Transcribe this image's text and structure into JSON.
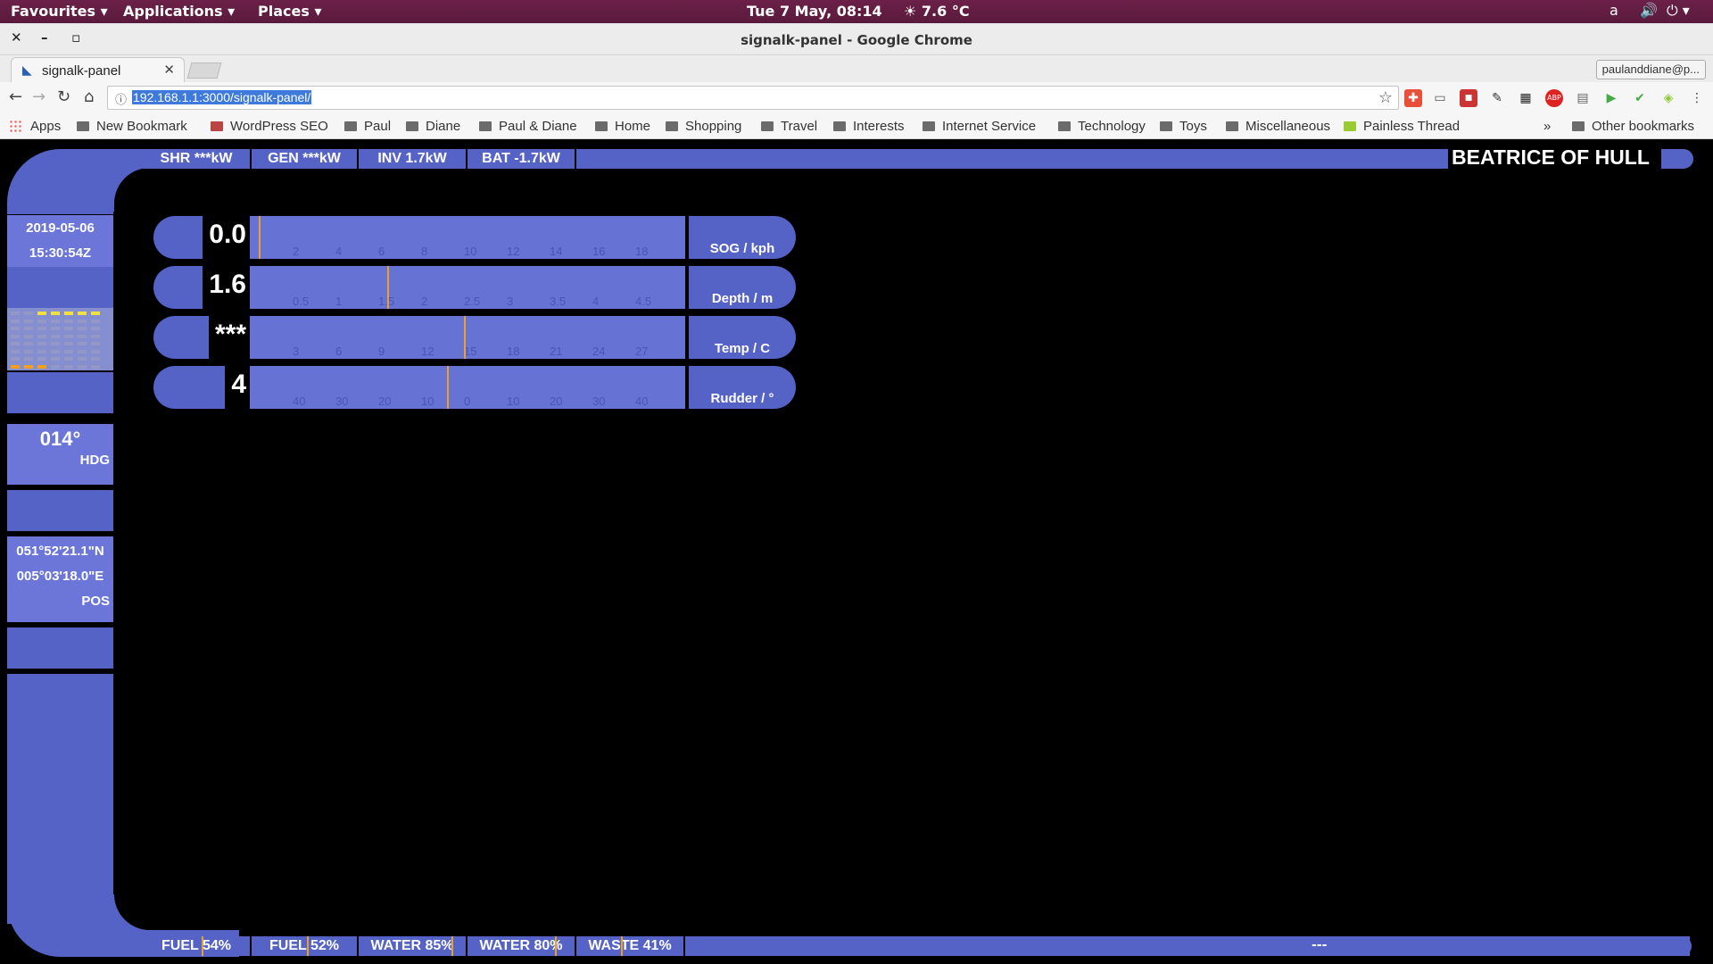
{
  "topbar": {
    "favourites": "Favourites",
    "applications": "Applications",
    "places": "Places",
    "clock": "Tue  7 May, 08:14",
    "weather": "7.6 °C"
  },
  "window": {
    "title": "signalk-panel - Google Chrome"
  },
  "tabs": [
    {
      "label": "signalk-panel"
    }
  ],
  "profile": "paulanddiane@p...",
  "omnibox": {
    "url": "192.168.1.1:3000/signalk-panel/"
  },
  "bookmarks": {
    "apps": "Apps",
    "items": [
      "New Bookmark",
      "WordPress SEO",
      "Paul",
      "Diane",
      "Paul & Diane",
      "Home",
      "Shopping",
      "Travel",
      "Interests",
      "Internet Service",
      "Technology",
      "Toys",
      "Miscellaneous",
      "Painless Thread"
    ],
    "overflow": "»",
    "other": "Other bookmarks"
  },
  "panel": {
    "ship_name": "BEATRICE OF HULL",
    "top_strip": [
      "SHR ***kW",
      "GEN ***kW",
      "INV 1.7kW",
      "BAT -1.7kW"
    ],
    "bottom_strip": [
      "FUEL 54%",
      "FUEL 52%",
      "WATER 85%",
      "WATER 80%",
      "WASTE 41%"
    ],
    "bottom_tank_levels": [
      0.54,
      0.52,
      0.85,
      0.8,
      0.41
    ],
    "status_dashes": "---",
    "date": "2019-05-06",
    "time": "15:30:54Z",
    "heading_value": "014°",
    "heading_label": "HDG",
    "position_lat": "051°52'21.1\"N",
    "position_lon": "005°03'18.0\"E",
    "position_label": "POS",
    "gauges": [
      {
        "value": "0.0",
        "label": "SOG / kph",
        "ticks": [
          "2",
          "4",
          "6",
          "8",
          "10",
          "12",
          "14",
          "16",
          "18"
        ],
        "reading": 0
      },
      {
        "value": "1.6",
        "label": "Depth / m",
        "ticks": [
          "0.5",
          "1",
          "1.5",
          "2",
          "2.5",
          "3",
          "3.5",
          "4",
          "4.5"
        ],
        "reading": 1.6
      },
      {
        "value": "***",
        "label": "Temp / C",
        "ticks": [
          "3",
          "6",
          "9",
          "12",
          "15",
          "18",
          "21",
          "24",
          "27"
        ],
        "reading": 15
      },
      {
        "value": "4",
        "label": "Rudder / °",
        "ticks": [
          "40",
          "30",
          "20",
          "10",
          "0",
          "10",
          "20",
          "30",
          "40"
        ],
        "reading": 4
      }
    ]
  },
  "colors": {
    "lcars_blue": "#5563c6",
    "lcars_light": "#6672d4",
    "needle": "#e8a030",
    "ubuntu_panel": "#5a1a3c"
  }
}
